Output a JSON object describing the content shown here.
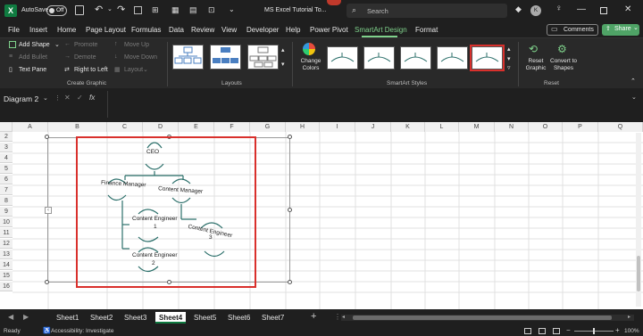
{
  "titlebar": {
    "autosave_label": "AutoSave",
    "autosave_state": "Off",
    "file_title": "MS Excel Tutorial To...",
    "search_placeholder": "Search",
    "avatar_initial": "K"
  },
  "menu": {
    "items": [
      "File",
      "Insert",
      "Home",
      "Page Layout",
      "Formulas",
      "Data",
      "Review",
      "View",
      "Developer",
      "Help",
      "Power Pivot",
      "SmartArt Design",
      "Format"
    ],
    "active": "SmartArt Design",
    "comments_label": "Comments",
    "share_label": "Share"
  },
  "ribbon": {
    "create_graphic": {
      "add_shape": "Add Shape",
      "add_bullet": "Add Bullet",
      "text_pane": "Text Pane",
      "promote": "Promote",
      "demote": "Demote",
      "right_to_left": "Right to Left",
      "move_up": "Move Up",
      "move_down": "Move Down",
      "layout": "Layout",
      "group_label": "Create Graphic"
    },
    "layouts_label": "Layouts",
    "change_colors_label": "Change Colors",
    "smartart_styles_label": "SmartArt Styles",
    "reset": {
      "reset_graphic": "Reset Graphic",
      "convert_to_shapes": "Convert to Shapes",
      "group_label": "Reset"
    }
  },
  "formulabar": {
    "name_box": "Diagram 2",
    "fx": "fx"
  },
  "grid": {
    "columns": [
      "A",
      "B",
      "C",
      "D",
      "E",
      "F",
      "G",
      "H",
      "I",
      "J",
      "K",
      "L",
      "M",
      "N",
      "O",
      "P",
      "Q"
    ],
    "rows": [
      "2",
      "3",
      "4",
      "5",
      "6",
      "7",
      "8",
      "9",
      "10",
      "11",
      "12",
      "13",
      "14",
      "15",
      "16"
    ]
  },
  "diagram": {
    "nodes": {
      "ceo": "CEO",
      "finance_manager": "Finance Manager",
      "content_manager": "Content Manager",
      "content_engineer_1_line1": "Content Engineer",
      "content_engineer_1_line2": "1",
      "content_engineer_2_line1": "Content Engineer",
      "content_engineer_2_line2": "2",
      "content_engineer_3_line1": "Content Engineer",
      "content_engineer_3_line2": "3"
    },
    "highlight_color": "#d9302c",
    "line_color": "#2b6f6a"
  },
  "sheets": {
    "tabs": [
      "Sheet1",
      "Sheet2",
      "Sheet3",
      "Sheet4",
      "Sheet5",
      "Sheet6",
      "Sheet7"
    ],
    "active": "Sheet4",
    "add_label": "+"
  },
  "status": {
    "ready": "Ready",
    "accessibility": "Accessibility: Investigate",
    "zoom": "100%"
  }
}
